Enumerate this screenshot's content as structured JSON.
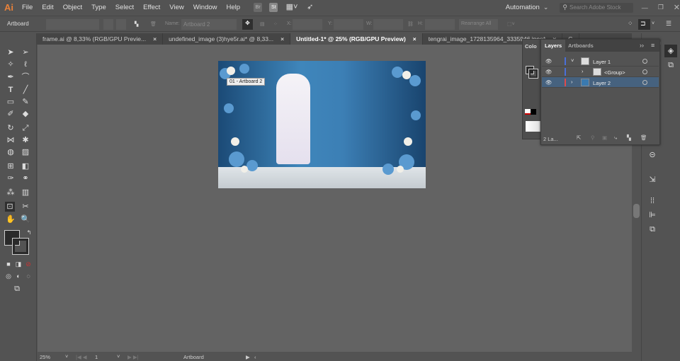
{
  "app": {
    "logo": "Ai",
    "menus": [
      "File",
      "Edit",
      "Object",
      "Type",
      "Select",
      "Effect",
      "View",
      "Window",
      "Help"
    ],
    "bridge": "Br",
    "stock": "St",
    "workspace": "Automation",
    "search_placeholder": "Search Adobe Stock"
  },
  "control": {
    "mode": "Artboard",
    "name_label": "Name:",
    "name_value": "Artboard 2",
    "x_label": "X:",
    "y_label": "Y:",
    "w_label": "W:",
    "h_label": "H:",
    "rearrange": "Rearrange All"
  },
  "tabs": [
    {
      "label": "frame.ai @ 8,33% (RGB/GPU Previe...",
      "close": "×"
    },
    {
      "label": "undefined_image (3)hye5r.ai* @ 8,33...",
      "close": "×"
    },
    {
      "label": "Untitled-1* @ 25% (RGB/GPU Preview)",
      "close": "×"
    },
    {
      "label": "tengrai_image_1728135964_3335946.jpeg*",
      "close": "×"
    },
    {
      "label": "G",
      "close": ""
    }
  ],
  "artboard_label": "01 - Artboard 2",
  "status": {
    "zoom": "25%",
    "page": "1",
    "tool": "Artboard"
  },
  "color_panel": {
    "title": "Colo"
  },
  "layers_panel": {
    "tabs": [
      "Layers",
      "Artboards"
    ],
    "rows": [
      {
        "name": "Layer 1",
        "color": "#4a6fd8"
      },
      {
        "name": "<Group>",
        "color": "#4a6fd8"
      },
      {
        "name": "Layer 2",
        "color": "#e04a4a"
      }
    ],
    "count": "2 La..."
  }
}
